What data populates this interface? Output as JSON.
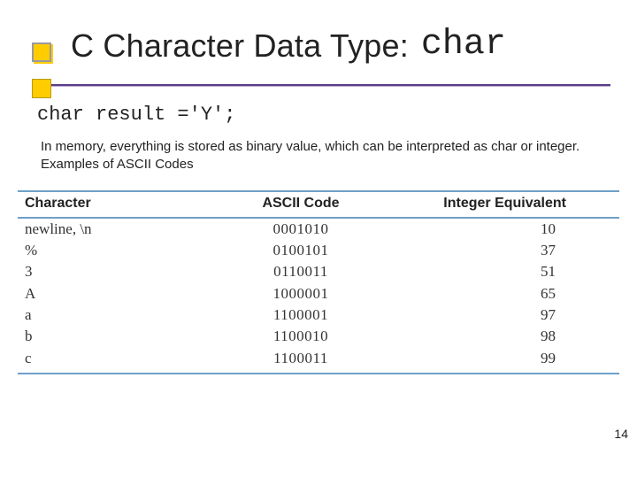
{
  "title": {
    "main": "C Character Data Type:",
    "code": "char"
  },
  "code_line": "char result ='Y';",
  "description": "In memory, everything is stored as binary value, which can be interpreted as char or integer. Examples of ASCII Codes",
  "table": {
    "headers": {
      "c": "Character",
      "a": "ASCII Code",
      "i": "Integer Equivalent"
    },
    "rows": [
      {
        "c": "newline, \\n",
        "a": "0001010",
        "i": "10"
      },
      {
        "c": "%",
        "a": "0100101",
        "i": "37"
      },
      {
        "c": "3",
        "a": "0110011",
        "i": "51"
      },
      {
        "c": "A",
        "a": "1000001",
        "i": "65"
      },
      {
        "c": "a",
        "a": "1100001",
        "i": "97"
      },
      {
        "c": "b",
        "a": "1100010",
        "i": "98"
      },
      {
        "c": "c",
        "a": "1100011",
        "i": "99"
      }
    ]
  },
  "page_number": "14",
  "chart_data": {
    "type": "table",
    "title": "Examples of ASCII Codes",
    "columns": [
      "Character",
      "ASCII Code",
      "Integer Equivalent"
    ],
    "rows": [
      [
        "newline, \\n",
        "0001010",
        10
      ],
      [
        "%",
        "0100101",
        37
      ],
      [
        "3",
        "0110011",
        51
      ],
      [
        "A",
        "1000001",
        65
      ],
      [
        "a",
        "1100001",
        97
      ],
      [
        "b",
        "1100010",
        98
      ],
      [
        "c",
        "1100011",
        99
      ]
    ]
  }
}
